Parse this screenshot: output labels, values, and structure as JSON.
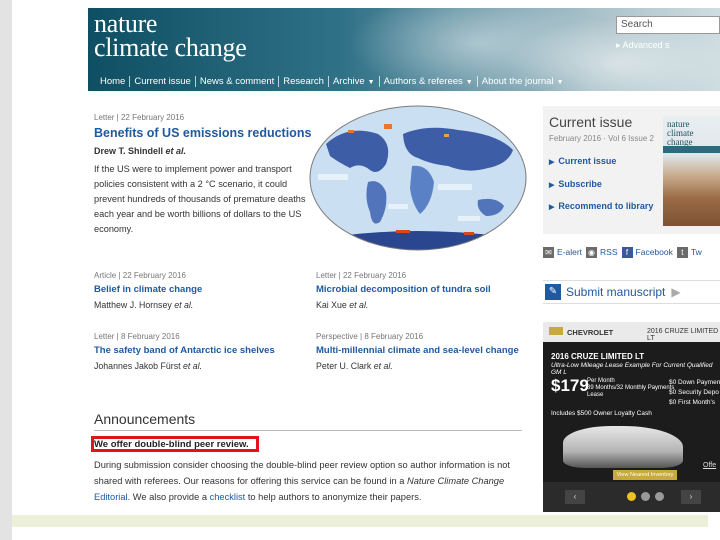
{
  "header": {
    "logo_line1": "nature",
    "logo_line2": "climate change",
    "search_placeholder": "Search",
    "advanced_search": "▸ Advanced s",
    "nav": [
      "Home",
      "Current issue",
      "News & comment",
      "Research",
      "Archive",
      "Authors & referees",
      "About the journal"
    ]
  },
  "feature": {
    "meta": "Letter | 22 February 2016",
    "title": "Benefits of US emissions reductions",
    "authors": "Drew T. Shindell et al.",
    "summary": "If the US were to implement power and transport policies consistent with a 2 °C scenario, it could prevent hundreds of thousands of premature deaths each year and be worth billions of dollars to the US economy."
  },
  "articles": [
    {
      "meta": "Article | 22 February 2016",
      "title": "Belief in climate change",
      "authors": "Matthew J. Hornsey et al."
    },
    {
      "meta": "Letter | 22 February 2016",
      "title": "Microbial decomposition of tundra soil",
      "authors": "Kai Xue et al."
    },
    {
      "meta": "Letter | 8 February 2016",
      "title": "The safety band of Antarctic ice shelves",
      "authors": "Johannes Jakob Fürst et al."
    },
    {
      "meta": "Perspective | 8 February 2016",
      "title": "Multi-millennial climate and sea-level change",
      "authors": "Peter U. Clark et al."
    }
  ],
  "announcements": {
    "title": "Announcements",
    "headline": "We offer double-blind peer review.",
    "body_1": "During submission consider choosing the double-blind peer review option so author information is not shared with referees. Our reasons for offering this service can be found in a ",
    "body_em": "Nature Climate Change",
    "body_link1": " Editorial",
    "body_2": ". We also provide a ",
    "body_link2": "checklist",
    "body_3": " to help authors to anonymize their papers."
  },
  "sidebar": {
    "current_title": "Current issue",
    "current_date": "February 2016 · Vol 6 Issue 2",
    "links": [
      "Current issue",
      "Subscribe",
      "Recommend to library"
    ],
    "cover_title_1": "nature",
    "cover_title_2": "climate change",
    "share": [
      {
        "label": "E-alert",
        "icon": "mail-icon",
        "color": "#6b6b6b"
      },
      {
        "label": "RSS",
        "icon": "rss-icon",
        "color": "#6b6b6b"
      },
      {
        "label": "Facebook",
        "icon": "facebook-icon",
        "color": "#3b5998"
      },
      {
        "label": "Tw",
        "icon": "twitter-icon",
        "color": "#6b6b6b"
      }
    ],
    "submit": "Submit manuscript"
  },
  "ad": {
    "brand": "CHEVROLET",
    "model": "2016 CRUZE LIMITED LT",
    "model_overlay": "2016 CRUZE LIMITED LT",
    "lease_line": "Ultra-Low Mileage Lease Example For Current Qualified GM L",
    "price": "$179",
    "terms": "Per Month\n39 Months/32 Monthly Payments\nLease",
    "downs": "$0 Down Paymen\n$0 Security Depo\n$0 First Month's",
    "bonus": "Includes $500 Owner Loyalty Cash",
    "cta": "View Nearest Inventory",
    "offer": "Offe",
    "prev": "‹",
    "next": "›"
  }
}
